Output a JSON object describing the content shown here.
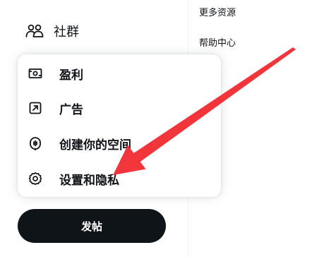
{
  "sidebar": {
    "community": {
      "label": "社群",
      "icon": "people-icon"
    }
  },
  "more_menu": {
    "items": [
      {
        "label": "盈利",
        "icon": "money-icon"
      },
      {
        "label": "广告",
        "icon": "external-arrow-icon"
      },
      {
        "label": "创建你的空间",
        "icon": "microphone-icon"
      },
      {
        "label": "设置和隐私",
        "icon": "gear-icon"
      }
    ]
  },
  "post_button": {
    "label": "发帖"
  },
  "right_panel": {
    "links": [
      "更多资源",
      "帮助中心"
    ]
  },
  "annotation": {
    "color": "#f2353b"
  }
}
